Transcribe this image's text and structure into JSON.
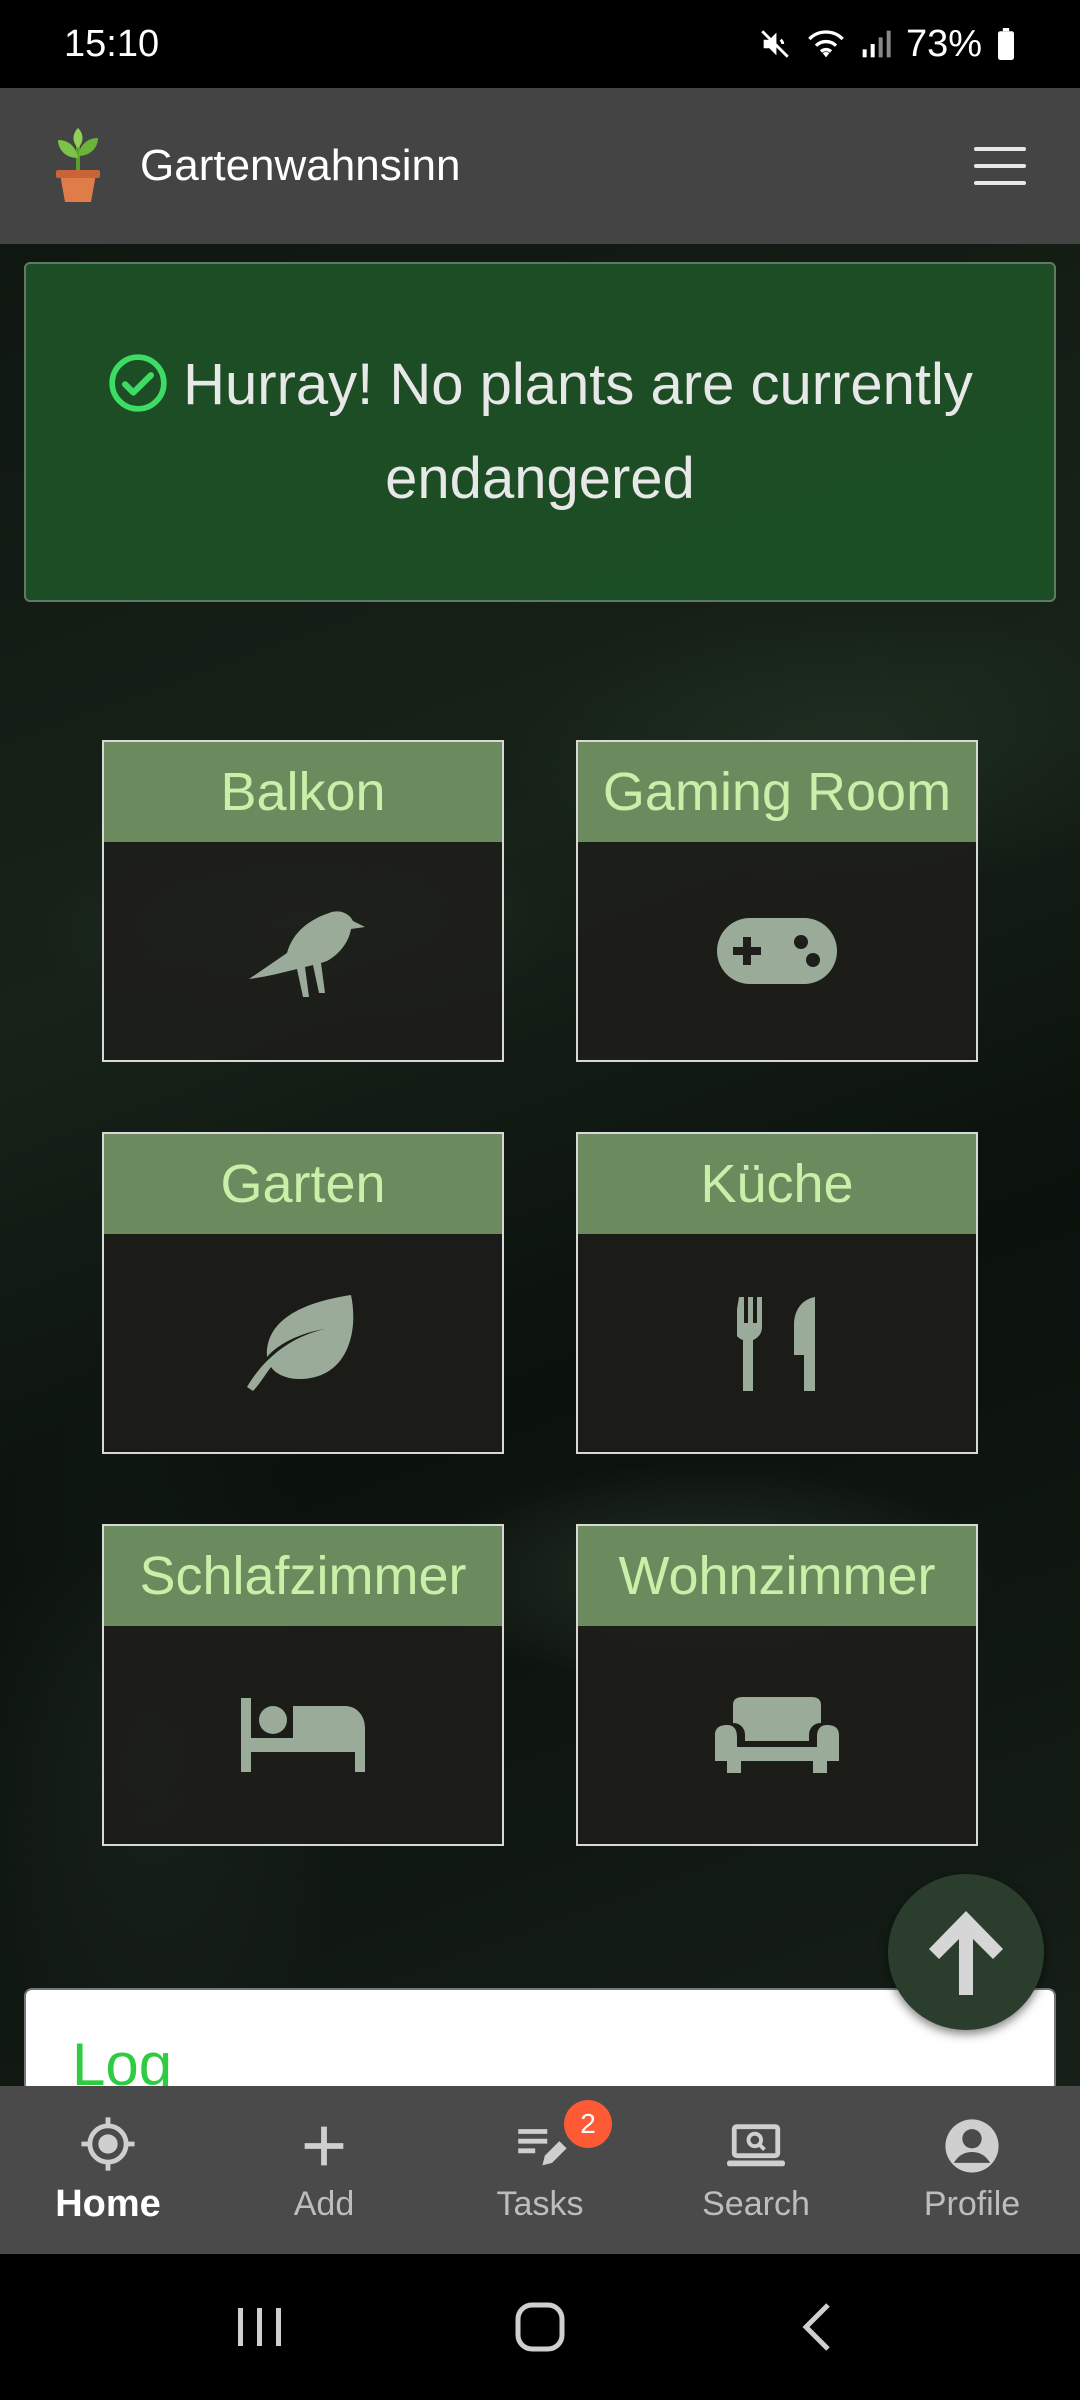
{
  "status_bar": {
    "time": "15:10",
    "battery": "73%"
  },
  "app_bar": {
    "title": "Gartenwahnsinn"
  },
  "alert": {
    "message": "Hurray! No plants are currently endangered"
  },
  "rooms": [
    {
      "name": "Balkon",
      "icon": "crow-icon"
    },
    {
      "name": "Gaming Room",
      "icon": "gamepad-icon"
    },
    {
      "name": "Garten",
      "icon": "leaf-icon"
    },
    {
      "name": "Küche",
      "icon": "utensils-icon"
    },
    {
      "name": "Schlafzimmer",
      "icon": "bed-icon"
    },
    {
      "name": "Wohnzimmer",
      "icon": "couch-icon"
    }
  ],
  "log": {
    "title": "Log"
  },
  "bottom_nav": {
    "items": [
      {
        "label": "Home",
        "icon": "crosshair-icon",
        "active": true
      },
      {
        "label": "Add",
        "icon": "plus-icon"
      },
      {
        "label": "Tasks",
        "icon": "edit-list-icon",
        "badge": "2"
      },
      {
        "label": "Search",
        "icon": "laptop-search-icon"
      },
      {
        "label": "Profile",
        "icon": "account-circle-icon"
      }
    ]
  },
  "colors": {
    "app_bar": "#444444",
    "alert_bg": "#1e5428",
    "tile_header": "#6b8a5e",
    "tile_label": "#c8f0a8",
    "icon_fill": "#9aab9a",
    "log_title": "#2ecc40",
    "badge": "#ff5a36"
  }
}
